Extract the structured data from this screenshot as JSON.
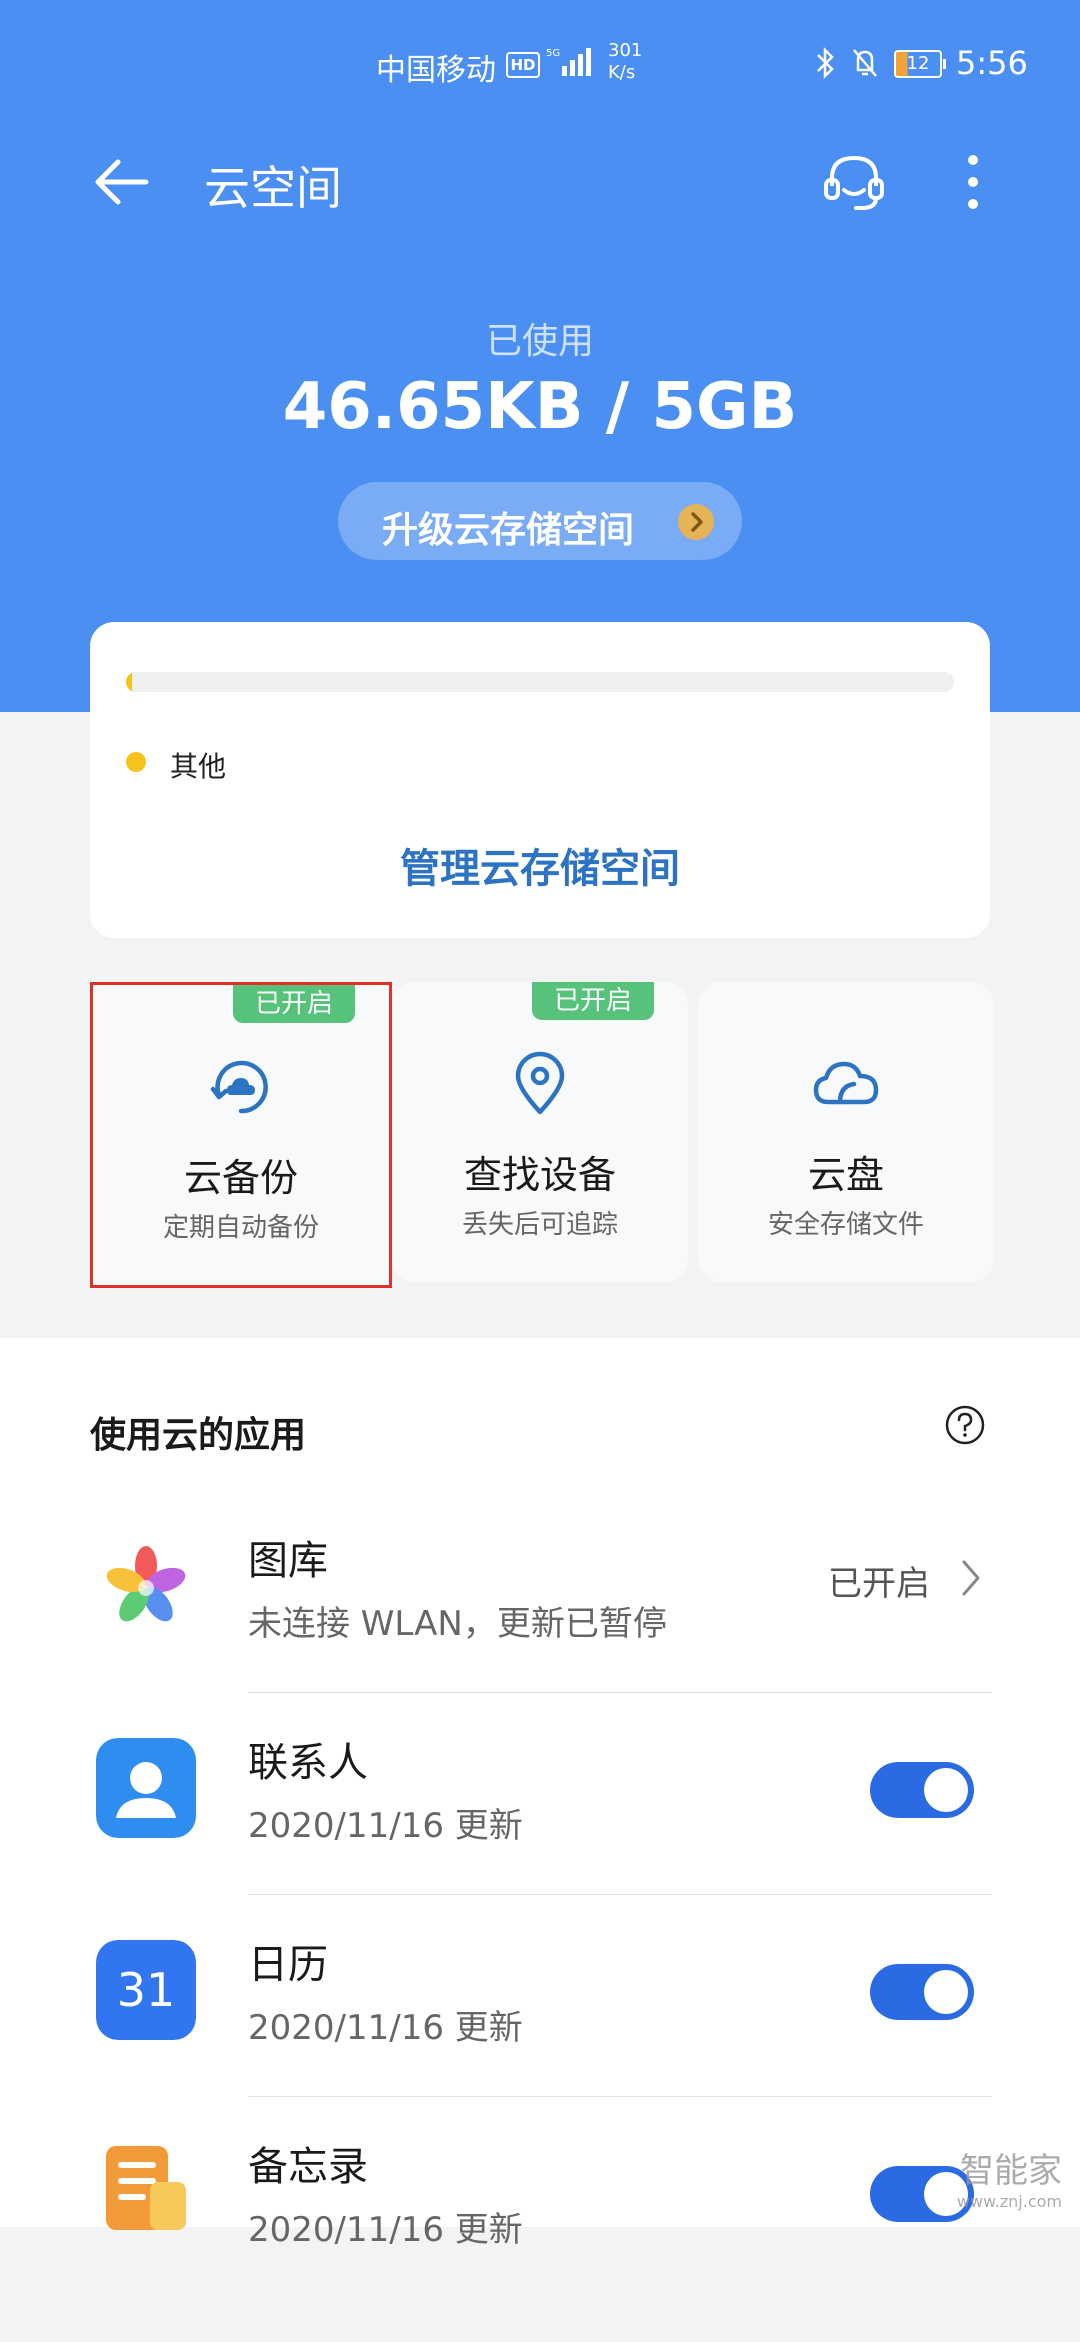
{
  "status_bar": {
    "carrier": "中国移动",
    "hd": "HD",
    "speed_value": "301",
    "speed_unit": "K/s",
    "battery": "12",
    "time": "5:56"
  },
  "header": {
    "title": "云空间",
    "used_label": "已使用",
    "used_value": "46.65KB / 5GB",
    "upgrade_label": "升级云存储空间"
  },
  "storage": {
    "used_fraction": 0.0001,
    "legend_label": "其他",
    "manage_label": "管理云存储空间"
  },
  "features": [
    {
      "badge": "已开启",
      "title": "云备份",
      "subtitle": "定期自动备份",
      "icon": "cloud-backup-icon",
      "highlighted": true
    },
    {
      "badge": "已开启",
      "title": "查找设备",
      "subtitle": "丢失后可追踪",
      "icon": "location-pin-icon"
    },
    {
      "title": "云盘",
      "subtitle": "安全存储文件",
      "icon": "cloud-drive-icon"
    }
  ],
  "apps": {
    "section_title": "使用云的应用",
    "items": [
      {
        "name": "图库",
        "subtitle": "未连接 WLAN，更新已暂停",
        "status": "已开启",
        "icon": "gallery-icon"
      },
      {
        "name": "联系人",
        "subtitle": "2020/11/16 更新",
        "toggle_on": true,
        "icon": "contacts-icon"
      },
      {
        "name": "日历",
        "subtitle": "2020/11/16 更新",
        "toggle_on": true,
        "icon": "calendar-icon",
        "icon_text": "31"
      },
      {
        "name": "备忘录",
        "subtitle": "2020/11/16 更新",
        "toggle_on": true,
        "icon": "notes-icon"
      }
    ]
  },
  "watermark": {
    "main": "智能家",
    "sub": "www.znj.com"
  },
  "colors": {
    "header_blue": "#4b8ff2",
    "accent_blue": "#2c73c4",
    "toggle_blue": "#2a6be4",
    "badge_green": "#56c27a",
    "legend_yellow": "#f6c21c"
  }
}
